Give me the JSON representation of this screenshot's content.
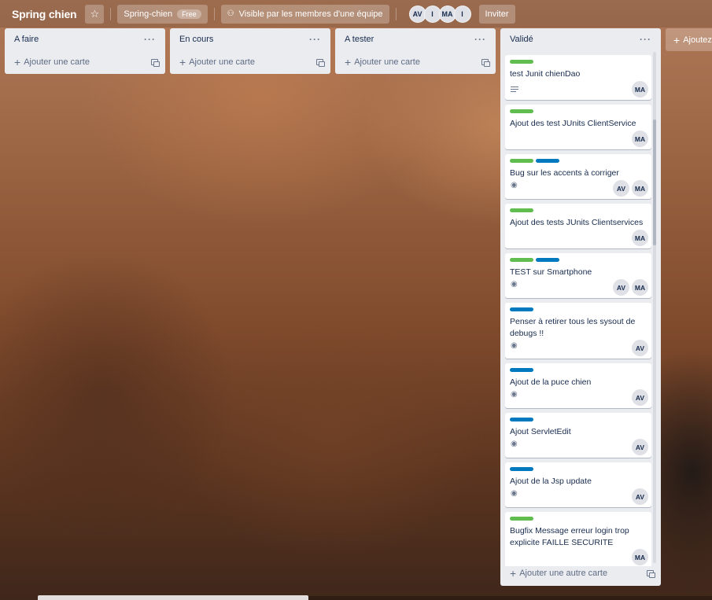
{
  "header": {
    "board_title": "Spring chien",
    "star_icon": "star-icon",
    "team_name": "Spring-chien",
    "plan_badge": "Free",
    "visibility_icon": "team-visibility-icon",
    "visibility_label": "Visible par les membres d'une équipe",
    "members": [
      "AV",
      "I",
      "MA",
      "I"
    ],
    "invite_label": "Inviter"
  },
  "lists": [
    {
      "title": "A faire",
      "add_card": "Ajouter une carte"
    },
    {
      "title": "En cours",
      "add_card": "Ajouter une carte"
    },
    {
      "title": "A tester",
      "add_card": "Ajouter une carte"
    },
    {
      "title": "Validé",
      "add_card": "Ajouter une autre carte",
      "cards": [
        {
          "title": "test Junit chienDao",
          "labels": [
            "#61bd4f"
          ],
          "badge": "description-icon",
          "members": [
            "MA"
          ]
        },
        {
          "title": "Ajout des test JUnits ClientService",
          "labels": [
            "#61bd4f"
          ],
          "badge": "",
          "members": [
            "MA"
          ]
        },
        {
          "title": "Bug sur les accents à corriger",
          "labels": [
            "#61bd4f",
            "#0079bf"
          ],
          "badge": "eye-icon",
          "members": [
            "AV",
            "MA"
          ]
        },
        {
          "title": "Ajout des tests JUnits Clientservices",
          "labels": [
            "#61bd4f"
          ],
          "badge": "",
          "members": [
            "MA"
          ]
        },
        {
          "title": "TEST sur Smartphone",
          "labels": [
            "#61bd4f",
            "#0079bf"
          ],
          "badge": "eye-icon",
          "members": [
            "AV",
            "MA"
          ]
        },
        {
          "title": "Penser à retirer tous les sysout de debugs !!",
          "labels": [
            "#0079bf"
          ],
          "badge": "eye-icon",
          "members": [
            "AV"
          ]
        },
        {
          "title": "Ajout de la puce chien",
          "labels": [
            "#0079bf"
          ],
          "badge": "eye-icon",
          "members": [
            "AV"
          ]
        },
        {
          "title": "Ajout ServletEdit",
          "labels": [
            "#0079bf"
          ],
          "badge": "eye-icon",
          "members": [
            "AV"
          ]
        },
        {
          "title": "Ajout de la Jsp update",
          "labels": [
            "#0079bf"
          ],
          "badge": "eye-icon",
          "members": [
            "AV"
          ]
        },
        {
          "title": "Bugfix Message erreur login trop explicite FAILLE SECURITE",
          "labels": [
            "#61bd4f"
          ],
          "badge": "",
          "members": [
            "MA"
          ]
        }
      ]
    }
  ],
  "add_list_label": "Ajoutez"
}
